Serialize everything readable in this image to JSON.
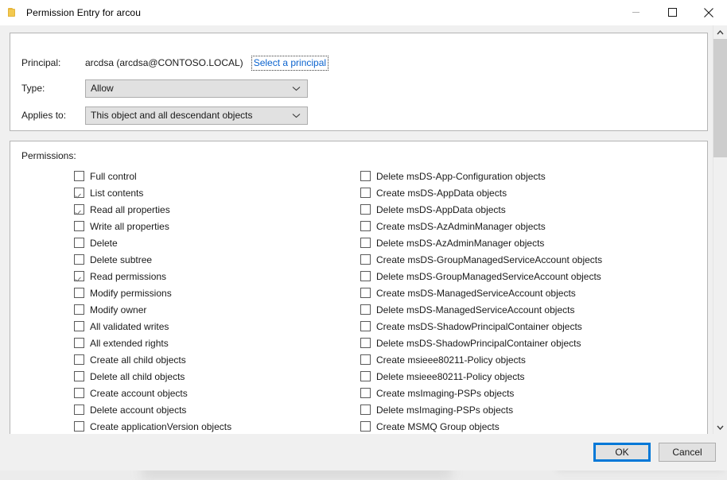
{
  "window": {
    "title": "Permission Entry for arcou",
    "icon": "folder-icon",
    "controls": {
      "minimize": "minimize-icon",
      "maximize": "maximize-icon",
      "close": "close-icon"
    }
  },
  "principal_panel": {
    "principal_label": "Principal:",
    "principal_value": "arcdsa (arcdsa@CONTOSO.LOCAL)",
    "select_principal_link": "Select a principal",
    "type_label": "Type:",
    "type_value": "Allow",
    "applies_to_label": "Applies to:",
    "applies_to_value": "This object and all descendant objects"
  },
  "permissions_panel": {
    "title": "Permissions:",
    "left_column": [
      {
        "label": "Full control",
        "checked": false
      },
      {
        "label": "List contents",
        "checked": true
      },
      {
        "label": "Read all properties",
        "checked": true
      },
      {
        "label": "Write all properties",
        "checked": false
      },
      {
        "label": "Delete",
        "checked": false
      },
      {
        "label": "Delete subtree",
        "checked": false
      },
      {
        "label": "Read permissions",
        "checked": true
      },
      {
        "label": "Modify permissions",
        "checked": false
      },
      {
        "label": "Modify owner",
        "checked": false
      },
      {
        "label": "All validated writes",
        "checked": false
      },
      {
        "label": "All extended rights",
        "checked": false
      },
      {
        "label": "Create all child objects",
        "checked": false
      },
      {
        "label": "Delete all child objects",
        "checked": false
      },
      {
        "label": "Create account objects",
        "checked": false
      },
      {
        "label": "Delete account objects",
        "checked": false
      },
      {
        "label": "Create applicationVersion objects",
        "checked": false
      }
    ],
    "right_column": [
      {
        "label": "Delete msDS-App-Configuration objects",
        "checked": false
      },
      {
        "label": "Create msDS-AppData objects",
        "checked": false
      },
      {
        "label": "Delete msDS-AppData objects",
        "checked": false
      },
      {
        "label": "Create msDS-AzAdminManager objects",
        "checked": false
      },
      {
        "label": "Delete msDS-AzAdminManager objects",
        "checked": false
      },
      {
        "label": "Create msDS-GroupManagedServiceAccount objects",
        "checked": false
      },
      {
        "label": "Delete msDS-GroupManagedServiceAccount objects",
        "checked": false
      },
      {
        "label": "Create msDS-ManagedServiceAccount objects",
        "checked": false
      },
      {
        "label": "Delete msDS-ManagedServiceAccount objects",
        "checked": false
      },
      {
        "label": "Create msDS-ShadowPrincipalContainer objects",
        "checked": false
      },
      {
        "label": "Delete msDS-ShadowPrincipalContainer objects",
        "checked": false
      },
      {
        "label": "Create msieee80211-Policy objects",
        "checked": false
      },
      {
        "label": "Delete msieee80211-Policy objects",
        "checked": false
      },
      {
        "label": "Create msImaging-PSPs objects",
        "checked": false
      },
      {
        "label": "Delete msImaging-PSPs objects",
        "checked": false
      },
      {
        "label": "Create MSMQ Group objects",
        "checked": false
      }
    ]
  },
  "footer": {
    "ok_label": "OK",
    "cancel_label": "Cancel"
  },
  "colors": {
    "accent": "#0078d7",
    "link": "#0b63ce",
    "dialog_bg": "#f0f0f0",
    "panel_bg": "#ffffff",
    "combo_bg": "#e1e1e1"
  }
}
